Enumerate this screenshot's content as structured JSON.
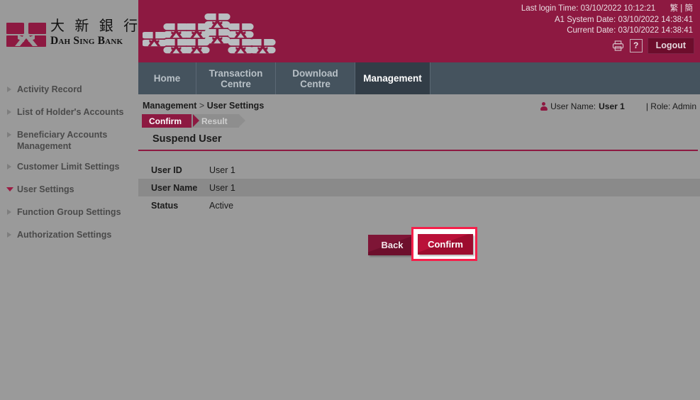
{
  "brand": {
    "name_cn": "大 新 銀 行",
    "name_en": "Dah Sing Bank",
    "logo_icon": "dah-sing-emblem-icon",
    "color": "#8d1941"
  },
  "banner": {
    "last_login_label": "Last login Time:",
    "last_login_value": "03/10/2022 10:12:21",
    "system_date_label": "A1 System Date:",
    "system_date_value": "03/10/2022 14:38:41",
    "current_date_label": "Current Date:",
    "current_date_value": "03/10/2022 14:38:41",
    "lang_traditional": "繁",
    "lang_divider": "|",
    "lang_simplified": "簡",
    "print_icon": "printer-icon",
    "help_label": "?",
    "logout_label": "Logout",
    "background_color": "#8d1941"
  },
  "tabs": [
    {
      "label": "Home",
      "active": false
    },
    {
      "label": "Transaction\nCentre",
      "active": false
    },
    {
      "label": "Download\nCentre",
      "active": false
    },
    {
      "label": "Management",
      "active": true
    }
  ],
  "breadcrumb": {
    "root": "Management",
    "separator": ">",
    "current": "User Settings"
  },
  "user_info": {
    "icon": "person-icon",
    "name_label": "User Name:",
    "name_value": "User 1",
    "role_text": "| Role: Admin"
  },
  "steps": [
    {
      "label": "Confirm",
      "state": "done"
    },
    {
      "label": "Result",
      "state": "todo"
    }
  ],
  "sidebar": {
    "items": [
      {
        "label": "Activity Record",
        "expanded": false
      },
      {
        "label": "List of Holder's Accounts",
        "expanded": false
      },
      {
        "label": "Beneficiary Accounts Management",
        "expanded": false
      },
      {
        "label": "Customer Limit Settings",
        "expanded": false
      },
      {
        "label": "User Settings",
        "expanded": true
      },
      {
        "label": "Function Group Settings",
        "expanded": false
      },
      {
        "label": "Authorization Settings",
        "expanded": false
      }
    ]
  },
  "page": {
    "title": "Suspend User",
    "rows": [
      {
        "label": "User ID",
        "value": "User 1"
      },
      {
        "label": "User Name",
        "value": "User 1"
      },
      {
        "label": "Status",
        "value": "Active"
      }
    ]
  },
  "actions": {
    "back_label": "Back",
    "confirm_label": "Confirm",
    "highlight_color": "#f5204a"
  }
}
